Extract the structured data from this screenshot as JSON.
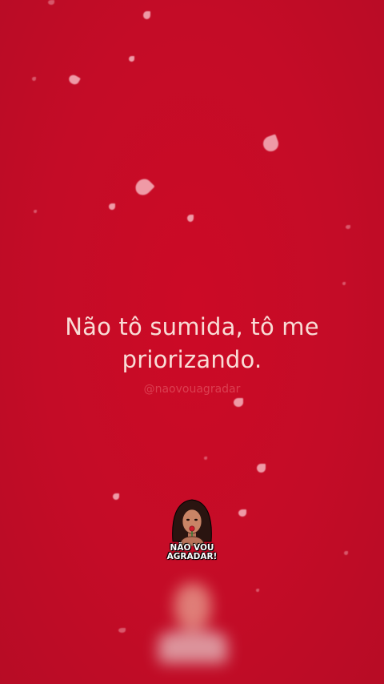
{
  "quote": {
    "line1": "Não tô sumida, tô me",
    "line2": "priorizando."
  },
  "watermark": "@naovouagradar",
  "logo": {
    "line1": "NÃO VOU",
    "line2": "AGRADAR!"
  },
  "colors": {
    "background": "#c8102a",
    "quote_text": "#f9dcd6",
    "petal": "#f6b3bd"
  }
}
